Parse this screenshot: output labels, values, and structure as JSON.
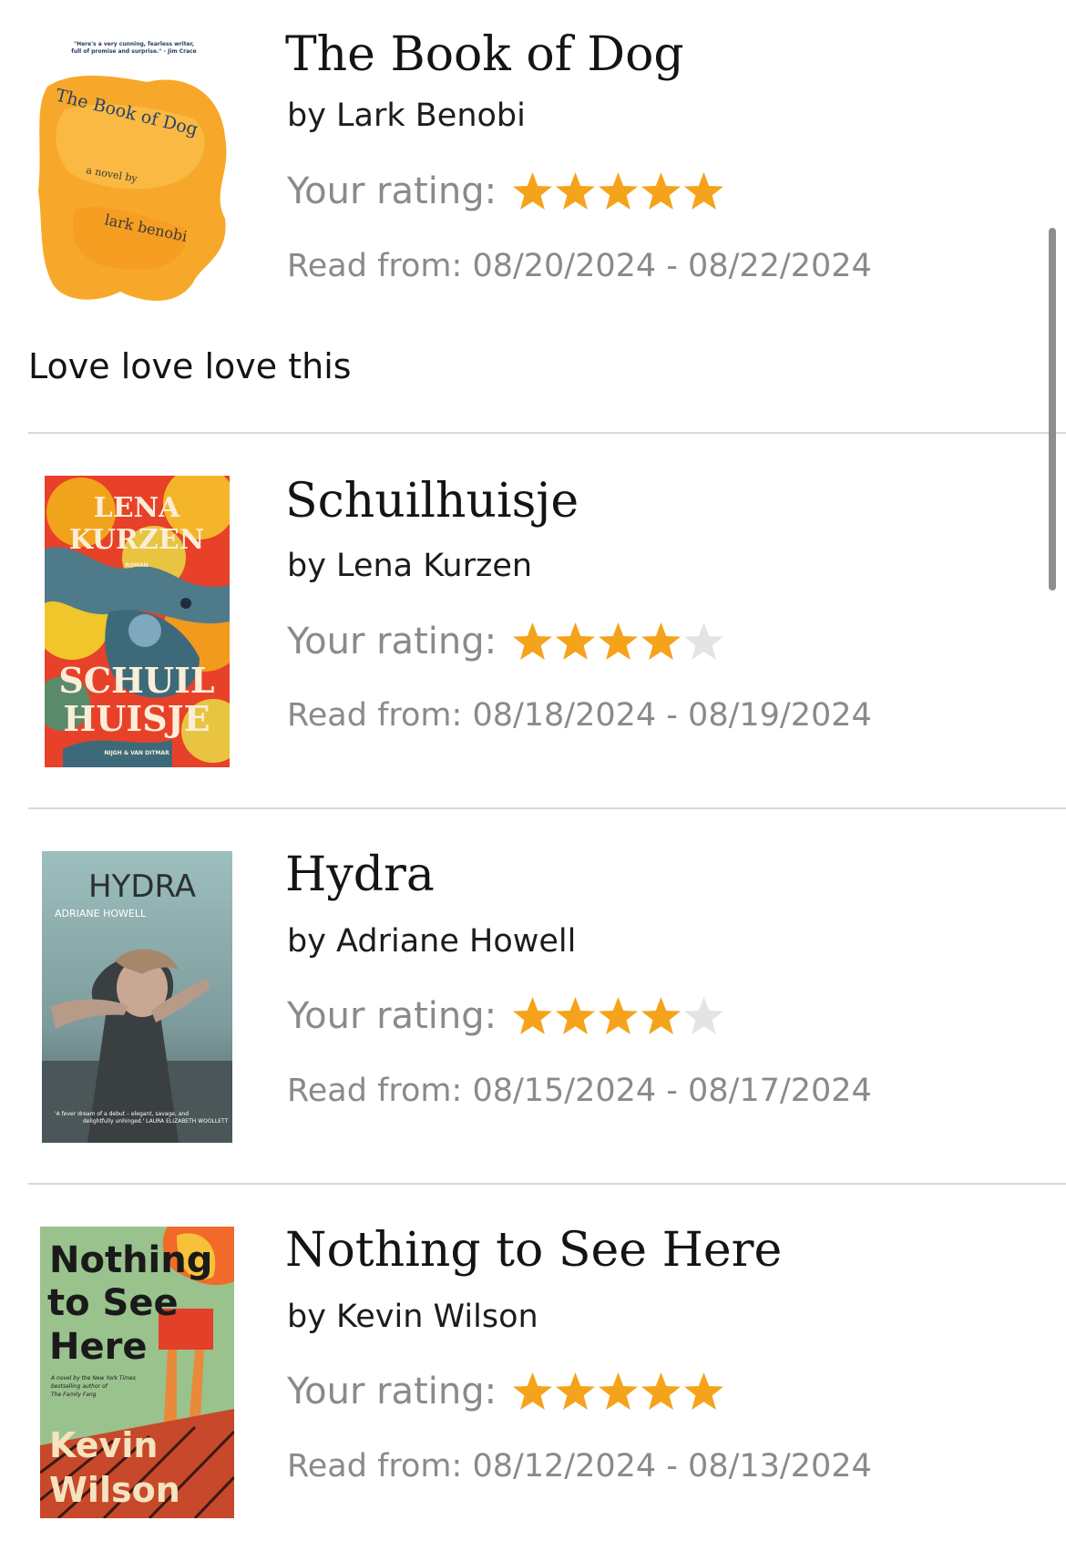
{
  "rating_label": "Your rating:",
  "read_prefix": "Read from:",
  "star_colors": {
    "filled": "#f5a31a",
    "empty": "#e4e4e4"
  },
  "books": [
    {
      "title": "The Book of Dog",
      "author": "by Lark Benobi",
      "rating": 5,
      "read_from": "Read from: 08/20/2024 - 08/22/2024",
      "review": "Love love love this",
      "cover": {
        "title_text": "The Book of Dog",
        "blurb": "\"Here's a very cunning, fearless writer, full of promise and surprise.\" - Jim Crace",
        "subtitle": "a novel by",
        "author_text": "lark benobi"
      }
    },
    {
      "title": "Schuilhuisje",
      "author": "by Lena Kurzen",
      "rating": 4,
      "read_from": "Read from: 08/18/2024 - 08/19/2024",
      "cover": {
        "author_line1": "LENA",
        "author_line2": "KURZEN",
        "genre": "ROMAN",
        "title_line1": "SCHUIL",
        "title_line2": "HUISJE",
        "publisher": "NIJGH & VAN DITMAR"
      }
    },
    {
      "title": "Hydra",
      "author": "by Adriane Howell",
      "rating": 4,
      "read_from": "Read from: 08/15/2024 - 08/17/2024",
      "cover": {
        "title_text": "HYDRA",
        "author_text": "ADRIANE HOWELL",
        "quote_line1": "'A fever dream of a debut – elegant, savage, and",
        "quote_line2": "delightfully unhinged.' LAURA ELIZABETH WOOLLETT"
      }
    },
    {
      "title": "Nothing to See Here",
      "author": "by Kevin Wilson",
      "rating": 5,
      "read_from": "Read from: 08/12/2024 - 08/13/2024",
      "cover": {
        "title_line1": "Nothing",
        "title_line2": "to See",
        "title_line3": "Here",
        "tagline1": "A novel by the New York Times",
        "tagline2": "bestselling author of",
        "tagline3": "The Family Fang",
        "author_line1": "Kevin",
        "author_line2": "Wilson"
      }
    }
  ]
}
